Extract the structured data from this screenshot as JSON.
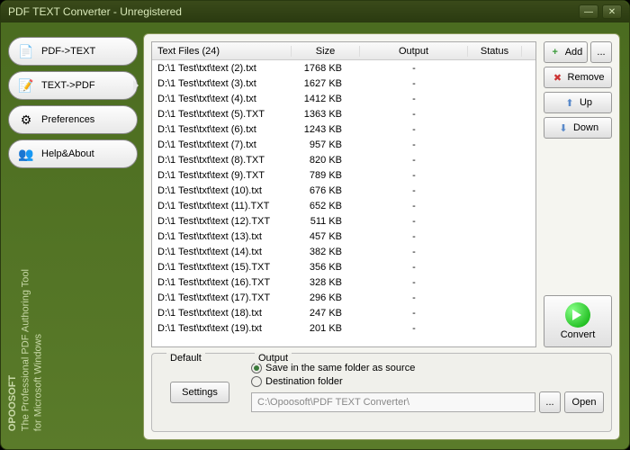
{
  "title": "PDF TEXT Converter - Unregistered",
  "sidebar": {
    "tabs": [
      {
        "label": "PDF->TEXT"
      },
      {
        "label": "TEXT->PDF"
      },
      {
        "label": "Preferences"
      },
      {
        "label": "Help&About"
      }
    ]
  },
  "vertical": {
    "brand": "OPOOSOFT",
    "line1": "The Professional PDF Authoring Tool",
    "line2": "for Microsoft Windows"
  },
  "table": {
    "header_files": "Text Files (24)",
    "header_size": "Size",
    "header_output": "Output",
    "header_status": "Status",
    "rows": [
      {
        "file": "D:\\1 Test\\txt\\text (2).txt",
        "size": "1768 KB",
        "output": "-"
      },
      {
        "file": "D:\\1 Test\\txt\\text (3).txt",
        "size": "1627 KB",
        "output": "-"
      },
      {
        "file": "D:\\1 Test\\txt\\text (4).txt",
        "size": "1412 KB",
        "output": "-"
      },
      {
        "file": "D:\\1 Test\\txt\\text (5).TXT",
        "size": "1363 KB",
        "output": "-"
      },
      {
        "file": "D:\\1 Test\\txt\\text (6).txt",
        "size": "1243 KB",
        "output": "-"
      },
      {
        "file": "D:\\1 Test\\txt\\text (7).txt",
        "size": "957 KB",
        "output": "-"
      },
      {
        "file": "D:\\1 Test\\txt\\text (8).TXT",
        "size": "820 KB",
        "output": "-"
      },
      {
        "file": "D:\\1 Test\\txt\\text (9).TXT",
        "size": "789 KB",
        "output": "-"
      },
      {
        "file": "D:\\1 Test\\txt\\text (10).txt",
        "size": "676 KB",
        "output": "-"
      },
      {
        "file": "D:\\1 Test\\txt\\text (11).TXT",
        "size": "652 KB",
        "output": "-"
      },
      {
        "file": "D:\\1 Test\\txt\\text (12).TXT",
        "size": "511 KB",
        "output": "-"
      },
      {
        "file": "D:\\1 Test\\txt\\text (13).txt",
        "size": "457 KB",
        "output": "-"
      },
      {
        "file": "D:\\1 Test\\txt\\text (14).txt",
        "size": "382 KB",
        "output": "-"
      },
      {
        "file": "D:\\1 Test\\txt\\text (15).TXT",
        "size": "356 KB",
        "output": "-"
      },
      {
        "file": "D:\\1 Test\\txt\\text (16).TXT",
        "size": "328 KB",
        "output": "-"
      },
      {
        "file": "D:\\1 Test\\txt\\text (17).TXT",
        "size": "296 KB",
        "output": "-"
      },
      {
        "file": "D:\\1 Test\\txt\\text (18).txt",
        "size": "247 KB",
        "output": "-"
      },
      {
        "file": "D:\\1 Test\\txt\\text (19).txt",
        "size": "201 KB",
        "output": "-"
      }
    ]
  },
  "actions": {
    "add": "Add",
    "remove": "Remove",
    "up": "Up",
    "down": "Down",
    "convert": "Convert",
    "ellipsis": "...",
    "open": "Open"
  },
  "bottom": {
    "default_label": "Default",
    "settings": "Settings",
    "output_label": "Output",
    "radio_same": "Save in the same folder as source",
    "radio_dest": "Destination folder",
    "path": "C:\\Opoosoft\\PDF TEXT Converter\\"
  }
}
